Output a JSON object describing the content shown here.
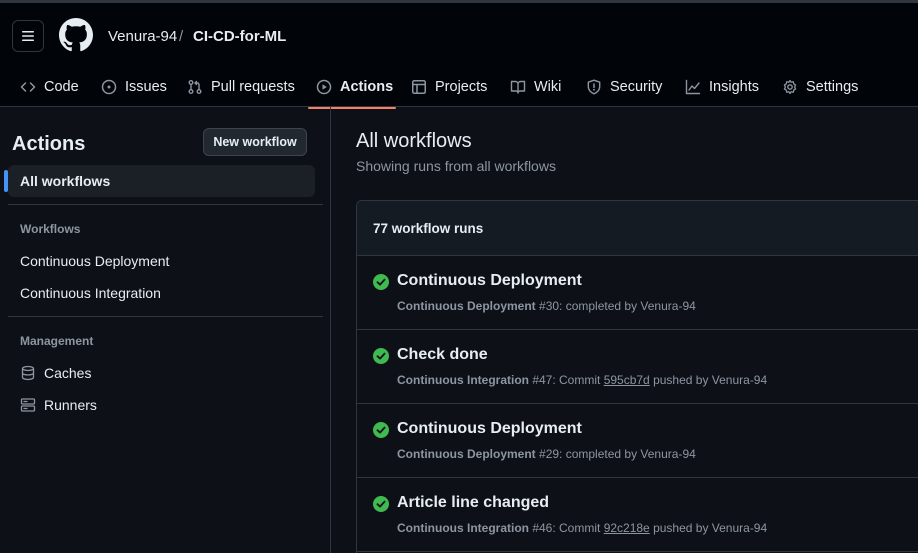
{
  "header": {
    "owner": "Venura-94",
    "separator": "/",
    "repo": "CI-CD-for-ML"
  },
  "tabs": [
    {
      "label": "Code",
      "icon": "code-icon"
    },
    {
      "label": "Issues",
      "icon": "issue-icon"
    },
    {
      "label": "Pull requests",
      "icon": "pull-request-icon"
    },
    {
      "label": "Actions",
      "icon": "play-icon",
      "active": true
    },
    {
      "label": "Projects",
      "icon": "table-icon"
    },
    {
      "label": "Wiki",
      "icon": "book-icon"
    },
    {
      "label": "Security",
      "icon": "shield-icon"
    },
    {
      "label": "Insights",
      "icon": "graph-icon"
    },
    {
      "label": "Settings",
      "icon": "gear-icon"
    }
  ],
  "sidebar": {
    "title": "Actions",
    "new_workflow": "New workflow",
    "all_workflows": "All workflows",
    "workflows_heading": "Workflows",
    "workflows": [
      "Continuous Deployment",
      "Continuous Integration"
    ],
    "management_heading": "Management",
    "management": [
      {
        "label": "Caches",
        "icon": "database-icon"
      },
      {
        "label": "Runners",
        "icon": "server-icon"
      }
    ]
  },
  "main": {
    "title": "All workflows",
    "subtitle": "Showing runs from all workflows",
    "runs_count": "77 workflow runs",
    "runs": [
      {
        "title": "Continuous Deployment",
        "workflow": "Continuous Deployment",
        "meta": "#30: completed by Venura-94",
        "status": "success"
      },
      {
        "title": "Check done",
        "workflow": "Continuous Integration",
        "pre": "#47: Commit ",
        "sha": "595cb7d",
        "post": " pushed by Venura-94",
        "status": "success"
      },
      {
        "title": "Continuous Deployment",
        "workflow": "Continuous Deployment",
        "meta": "#29: completed by Venura-94",
        "status": "success"
      },
      {
        "title": "Article line changed",
        "workflow": "Continuous Integration",
        "pre": "#46: Commit ",
        "sha": "92c218e",
        "post": " pushed by Venura-94",
        "status": "success"
      }
    ]
  },
  "colors": {
    "background": "#0d1117",
    "header_bg": "#010409",
    "border": "#30363d",
    "success": "#3fb950",
    "accent": "#f78166",
    "selected_bar": "#4493f8"
  }
}
